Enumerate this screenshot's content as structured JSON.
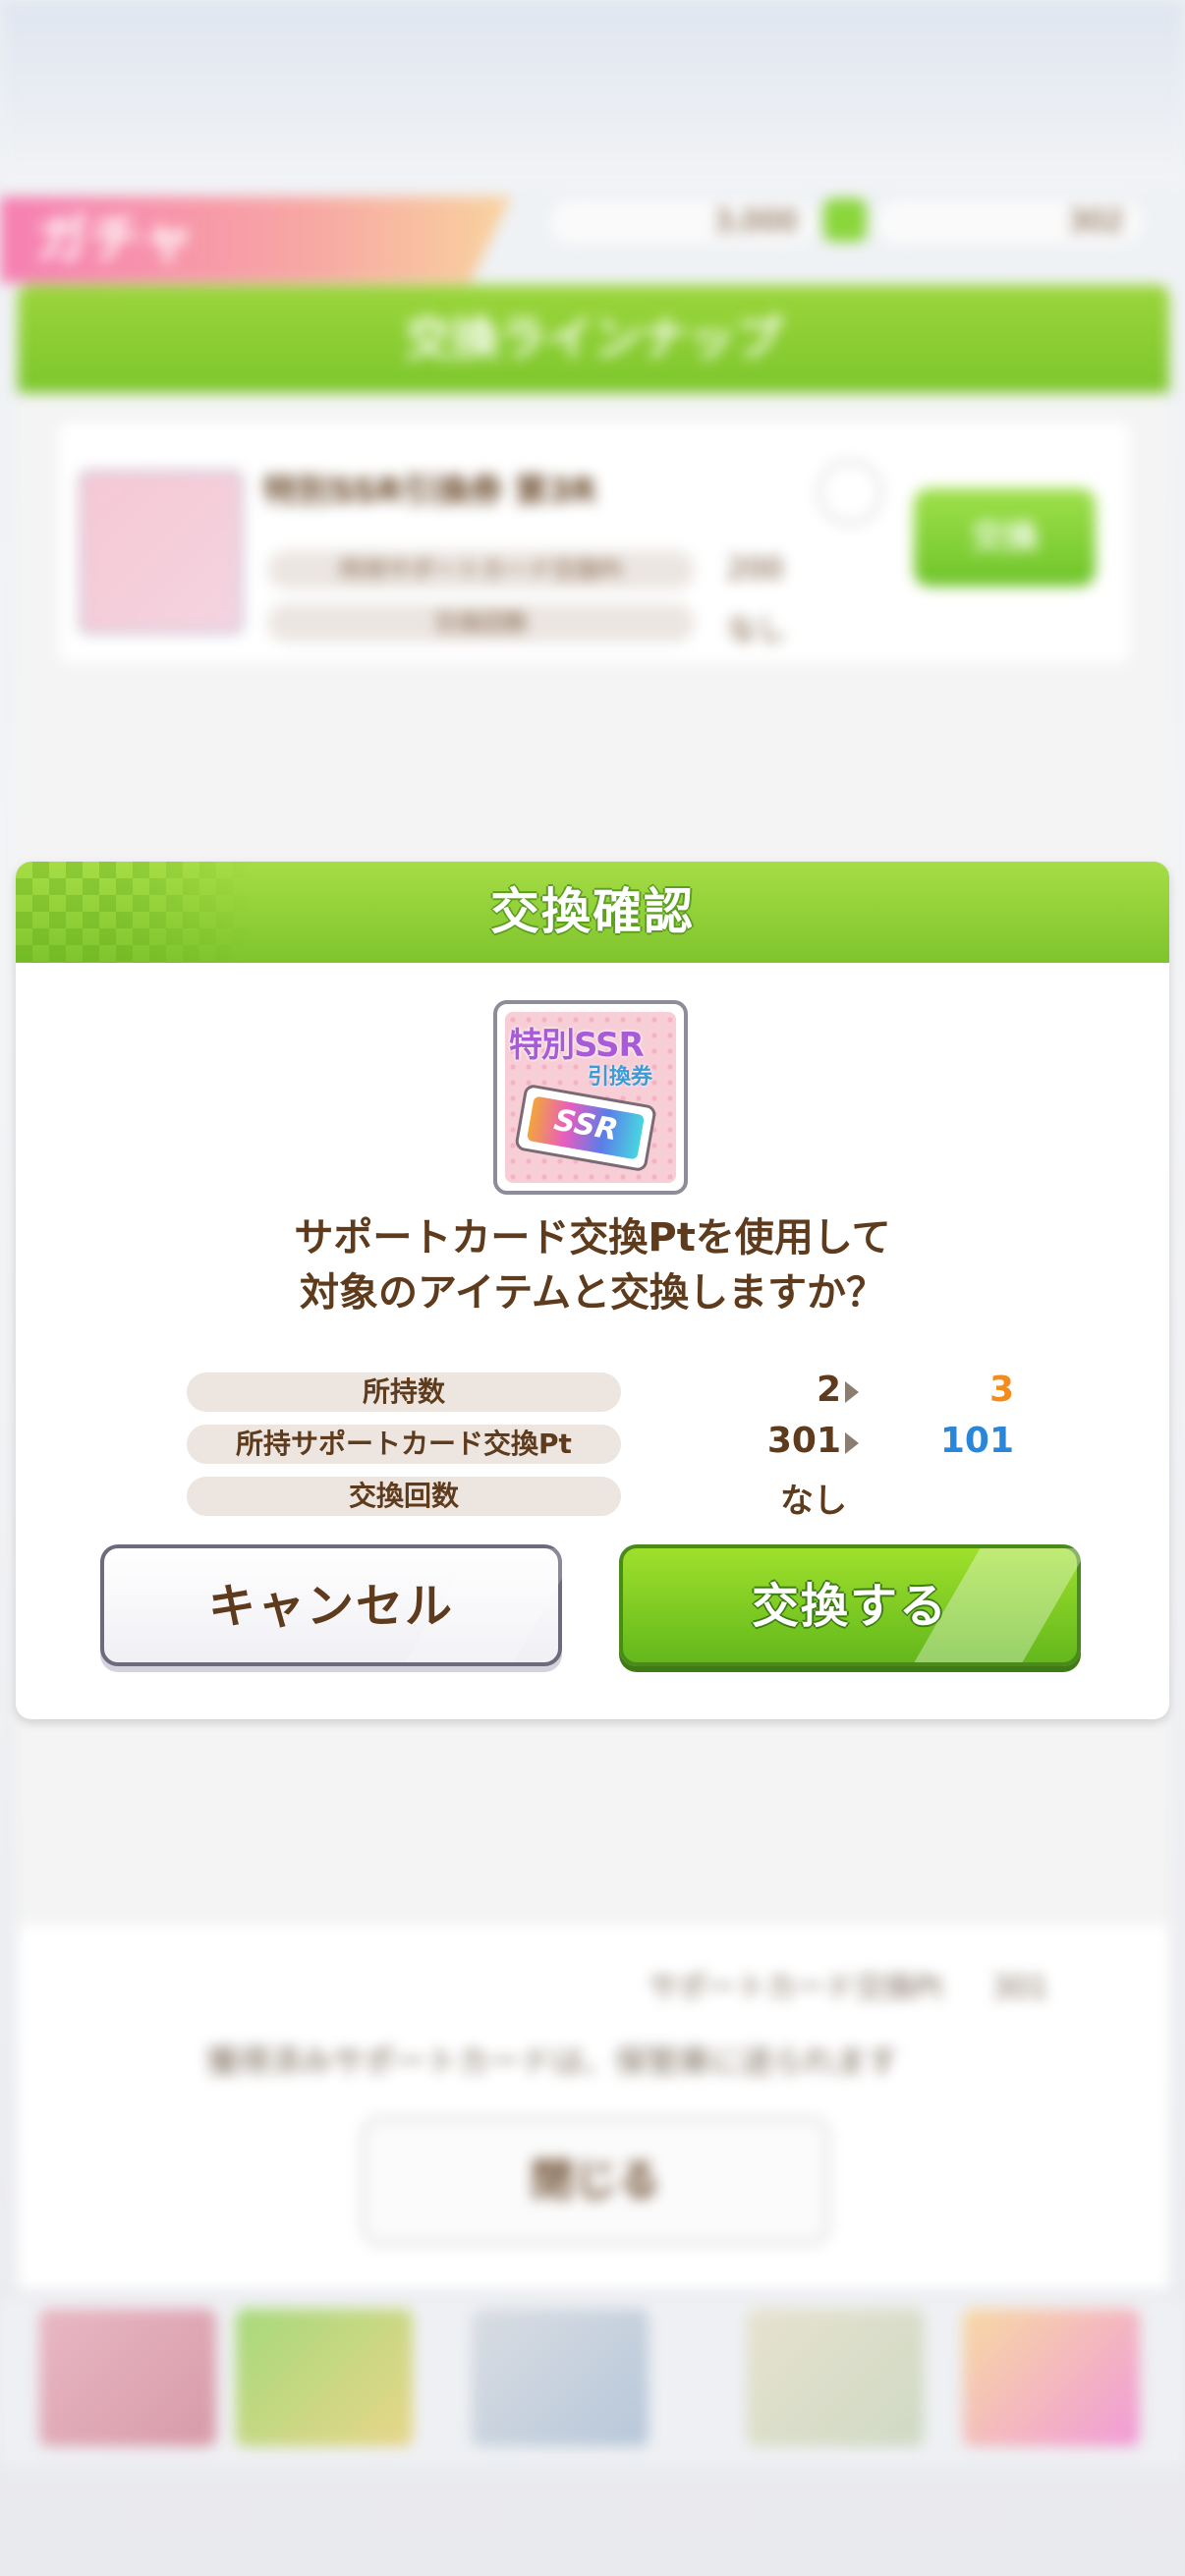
{
  "background": {
    "gacha_tab_label": "ガチャ",
    "currency_1": "3,000",
    "currency_2": "302",
    "lineup_title": "交換ラインナップ",
    "item_name": "特別SSR引換券 第3R",
    "item_row_labels": [
      "所持サポートカード交換Pt",
      "交換回数"
    ],
    "item_row_values": [
      "200",
      "なし"
    ],
    "exchange_button": "交換",
    "pt_label": "サポートカード交換Pt",
    "pt_value": "301",
    "note": "獲得済みサポートカードは、保管庫に送られます",
    "close_button": "閉じる"
  },
  "modal": {
    "title": "交換確認",
    "item_icon": {
      "title_text": "特別SSR",
      "subtitle_text": "引換券",
      "ticket_text": "SSR"
    },
    "question_lines": [
      "サポートカード交換Ptを使用して",
      "対象のアイテムと交換しますか？"
    ],
    "rows": [
      {
        "label": "所持数",
        "before": "2",
        "after": "3"
      },
      {
        "label": "所持サポートカード交換Pt",
        "before": "301",
        "after": "101"
      },
      {
        "label": "交換回数",
        "before": "なし",
        "after": ""
      }
    ],
    "cancel_label": "キャンセル",
    "confirm_label": "交換する"
  },
  "colors": {
    "accent_green": "#7fc42d",
    "text_brown": "#5e3b1c",
    "increase_orange": "#f28c1c",
    "decrease_blue": "#2a86d9"
  }
}
